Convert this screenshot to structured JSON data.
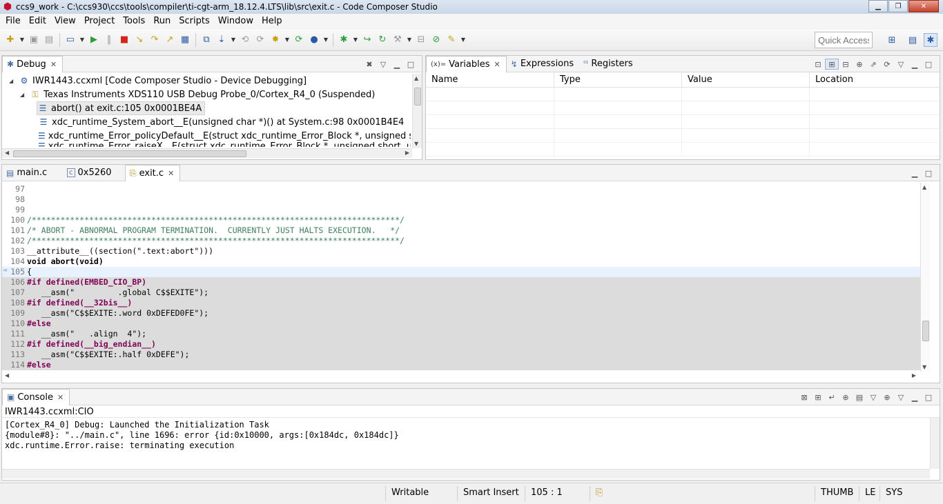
{
  "window": {
    "title": "ccs9_work - C:\\ccs930\\ccs\\tools\\compiler\\ti-cgt-arm_18.12.4.LTS\\lib\\src\\exit.c - Code Composer Studio",
    "minimize": "▁",
    "maximize": "❐",
    "close": "✕"
  },
  "menu": [
    "File",
    "Edit",
    "View",
    "Project",
    "Tools",
    "Run",
    "Scripts",
    "Window",
    "Help"
  ],
  "toolbar": {
    "quick_access": "Quick Access"
  },
  "debug_view": {
    "tab_label": "Debug",
    "tree": [
      {
        "label": "IWR1443.ccxml [Code Composer Studio - Device Debugging]",
        "icon": "gear-icon"
      },
      {
        "label": "Texas Instruments XDS110 USB Debug Probe_0/Cortex_R4_0 (Suspended)",
        "icon": "thread-icon"
      },
      {
        "label": "abort() at exit.c:105 0x0001BE4A",
        "icon": "stack-frame-icon"
      },
      {
        "label": "xdc_runtime_System_abort__E(unsigned char *)() at System.c:98 0x0001B4E4",
        "icon": "stack-frame-icon"
      },
      {
        "label": "xdc_runtime_Error_policyDefault__E(struct xdc_runtime_Error_Block *, unsigned short, unsig",
        "icon": "stack-frame-icon"
      },
      {
        "label": "xdc_runtime_Error_raiseX__E(struct xdc_runtime_Error_Block *, unsigned short, unsigned",
        "icon": "stack-frame-icon"
      }
    ]
  },
  "variables_view": {
    "tabs": [
      {
        "label": "Variables",
        "prefix": "(x)="
      },
      {
        "label": "Expressions",
        "prefix": ""
      },
      {
        "label": "Registers",
        "prefix": ""
      }
    ],
    "columns": [
      "Name",
      "Type",
      "Value",
      "Location"
    ]
  },
  "editor": {
    "tabs": [
      {
        "label": "main.c"
      },
      {
        "label": "0x5260"
      },
      {
        "label": "exit.c"
      }
    ],
    "lines": [
      {
        "n": "97",
        "text": ""
      },
      {
        "n": "98",
        "text": ""
      },
      {
        "n": "99",
        "text": ""
      },
      {
        "n": "100",
        "text": "/*****************************************************************************/"
      },
      {
        "n": "101",
        "text": "/* ABORT - ABNORMAL PROGRAM TERMINATION.  CURRENTLY JUST HALTS EXECUTION.   */"
      },
      {
        "n": "102",
        "text": "/*****************************************************************************/"
      },
      {
        "n": "103",
        "text": "__attribute__((section(\".text:abort\")))"
      },
      {
        "n": "104",
        "text": "void abort(void)"
      },
      {
        "n": "105",
        "text": "{"
      },
      {
        "n": "106",
        "text": "#if defined(EMBED_CIO_BP)"
      },
      {
        "n": "107",
        "text": "   __asm(\"         .global C$$EXITE\");"
      },
      {
        "n": "108",
        "text": "#if defined(__32bis__)"
      },
      {
        "n": "109",
        "text": "   __asm(\"C$$EXITE:.word 0xDEFED0FE\");"
      },
      {
        "n": "110",
        "text": "#else"
      },
      {
        "n": "111",
        "text": "   __asm(\"   .align  4\");"
      },
      {
        "n": "112",
        "text": "#if defined(__big_endian__)"
      },
      {
        "n": "113",
        "text": "   __asm(\"C$$EXITE:.half 0xDEFE\");"
      },
      {
        "n": "114",
        "text": "#else"
      }
    ]
  },
  "console_view": {
    "tab_label": "Console",
    "subtitle": "IWR1443.ccxml:CIO",
    "lines": [
      "[Cortex_R4_0] Debug: Launched the Initialization Task",
      "{module#8}: \"../main.c\", line 1696: error {id:0x10000, args:[0x184dc, 0x184dc]}",
      "xdc.runtime.Error.raise: terminating execution"
    ]
  },
  "statusbar": {
    "writable": "Writable",
    "insert_mode": "Smart Insert",
    "position": "105 : 1",
    "thumb": "THUMB",
    "endian": "LE",
    "sys": "SYS"
  }
}
